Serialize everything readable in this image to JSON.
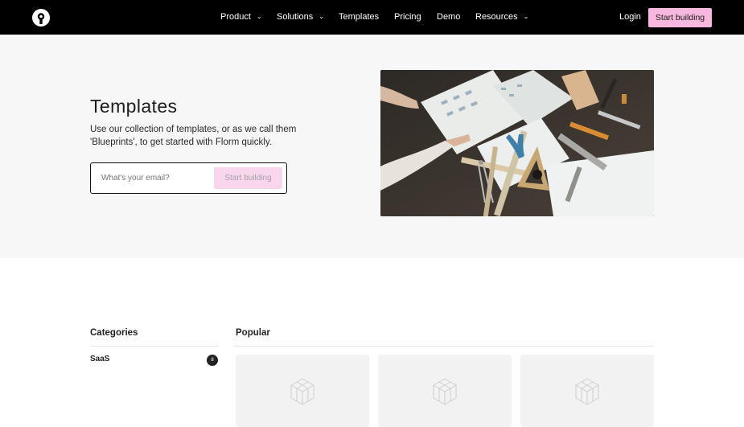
{
  "nav": {
    "items": [
      {
        "label": "Product",
        "dropdown": true
      },
      {
        "label": "Solutions",
        "dropdown": true
      },
      {
        "label": "Templates",
        "dropdown": false
      },
      {
        "label": "Pricing",
        "dropdown": false
      },
      {
        "label": "Demo",
        "dropdown": false
      },
      {
        "label": "Resources",
        "dropdown": true
      }
    ],
    "login": "Login",
    "cta": "Start building"
  },
  "hero": {
    "title": "Templates",
    "description": "Use our collection of templates, or as we call them 'Blueprints', to get started with Florm quickly.",
    "email_placeholder": "What's your email?",
    "cta": "Start building"
  },
  "categories": {
    "heading": "Categories",
    "items": [
      {
        "label": "SaaS",
        "count": "8"
      }
    ]
  },
  "popular": {
    "heading": "Popular",
    "cards": [
      {
        "icon": "cube-placeholder-icon"
      },
      {
        "icon": "cube-placeholder-icon"
      },
      {
        "icon": "cube-placeholder-icon"
      }
    ]
  },
  "colors": {
    "nav_bg": "#000000",
    "accent_pink": "#f8b7de",
    "hero_bg": "#f7f7f7"
  }
}
